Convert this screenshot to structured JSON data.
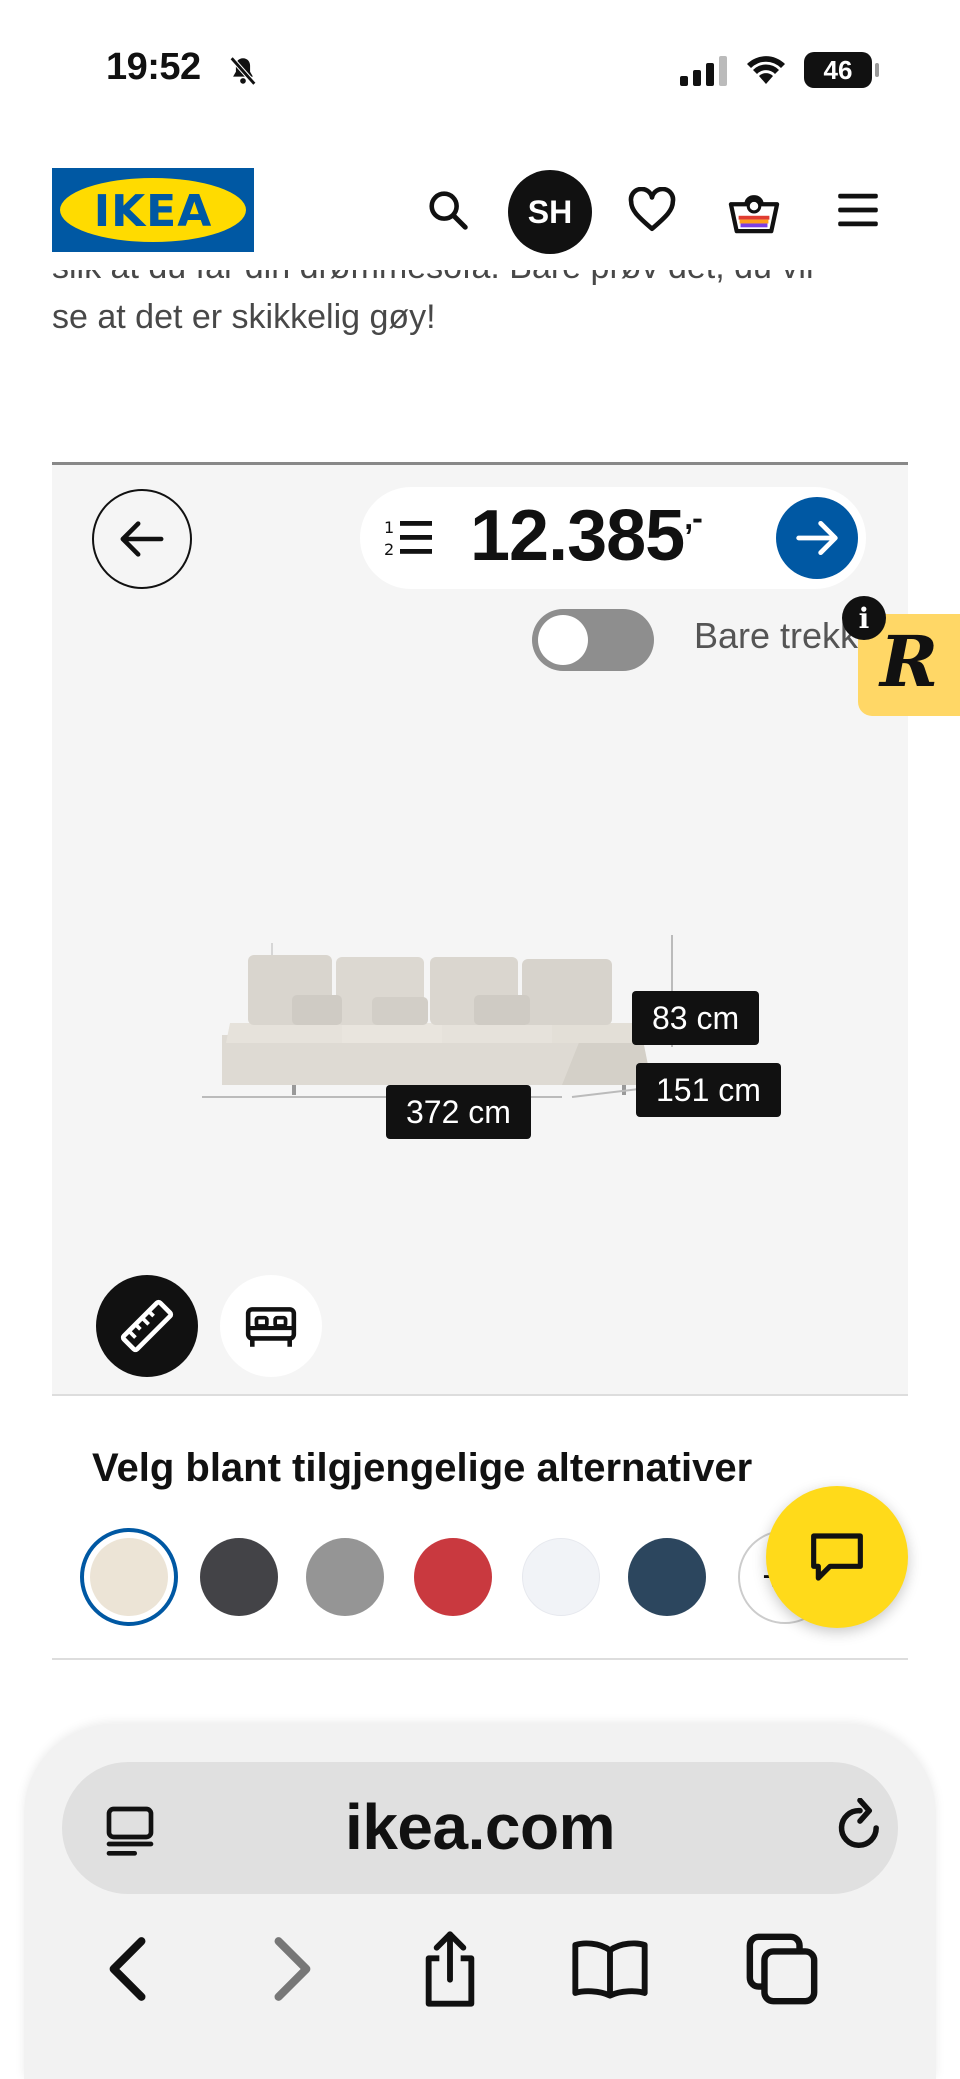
{
  "status_bar": {
    "time": "19:52",
    "battery": "46",
    "icons": [
      "bell-slash-icon",
      "cellular-signal-icon",
      "wifi-icon",
      "battery-icon"
    ]
  },
  "header": {
    "logo_text": "IKEA",
    "avatar_initials": "SH",
    "icons": [
      "search-icon",
      "heart-icon",
      "basket-icon",
      "menu-icon"
    ]
  },
  "intro": {
    "line1": "slik at du får din drømmesofa. Bare prøv det, du vil",
    "line2": "se at det er skikkelig gøy!"
  },
  "configurator": {
    "price": "12.385",
    "price_suffix": ",-",
    "toggle_label": "Bare trekk",
    "toggle_on": false,
    "dimensions": {
      "width": "372 cm",
      "height": "83 cm",
      "depth": "151 cm"
    }
  },
  "widget": {
    "letter": "R",
    "info": "i"
  },
  "options": {
    "title": "Velg blant tilgjengelige alternativer",
    "swatches": [
      {
        "name": "beige",
        "color": "#ece4d6",
        "selected": true
      },
      {
        "name": "dark-grey",
        "color": "#434347",
        "selected": false
      },
      {
        "name": "grey",
        "color": "#959595",
        "selected": false
      },
      {
        "name": "red",
        "color": "#c9393f",
        "selected": false
      },
      {
        "name": "white",
        "color": "#f1f3f7",
        "selected": false
      },
      {
        "name": "dark-blue",
        "color": "#2c465e",
        "selected": false
      }
    ],
    "more_label": "+"
  },
  "browser": {
    "url": "ikea.com"
  },
  "colors": {
    "ikea_blue": "#0058a3",
    "ikea_yellow": "#ffdb00",
    "chat_yellow": "#ffda1a"
  }
}
